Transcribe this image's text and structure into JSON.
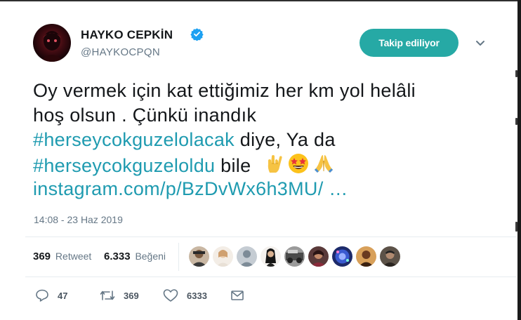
{
  "author": {
    "name": "HAYKO CEPKİN",
    "handle": "@HAYKOCPQN",
    "verified": true
  },
  "follow_button": {
    "label": "Takip ediliyor",
    "color": "#26a9a5"
  },
  "tweet": {
    "line1": "Oy vermek için kat ettiğimiz her km yol helâli",
    "line2": "hoş olsun . Çünkü inandık",
    "hashtag1": "#herseycokguzelolacak",
    "line3_rest": " diye, Ya da",
    "hashtag2": "#herseycokguzeloldu",
    "line4_rest": " bile",
    "emojis": [
      "rock-on-hand-emoji",
      "star-struck-emoji",
      "folded-hands-emoji"
    ],
    "link": "instagram.com/p/BzDvWx6h3MU/ …"
  },
  "timestamp": "14:08 - 23 Haz 2019",
  "stats": {
    "retweets_count": "369",
    "retweets_label": "Retweet",
    "likes_count": "6.333",
    "likes_label": "Beğeni",
    "liker_avatar_count": 9
  },
  "actions": {
    "reply_count": "47",
    "retweet_count": "369",
    "like_count": "6333"
  },
  "colors": {
    "link": "#1f9bb0",
    "muted": "#657786",
    "verified": "#1da1f2"
  }
}
